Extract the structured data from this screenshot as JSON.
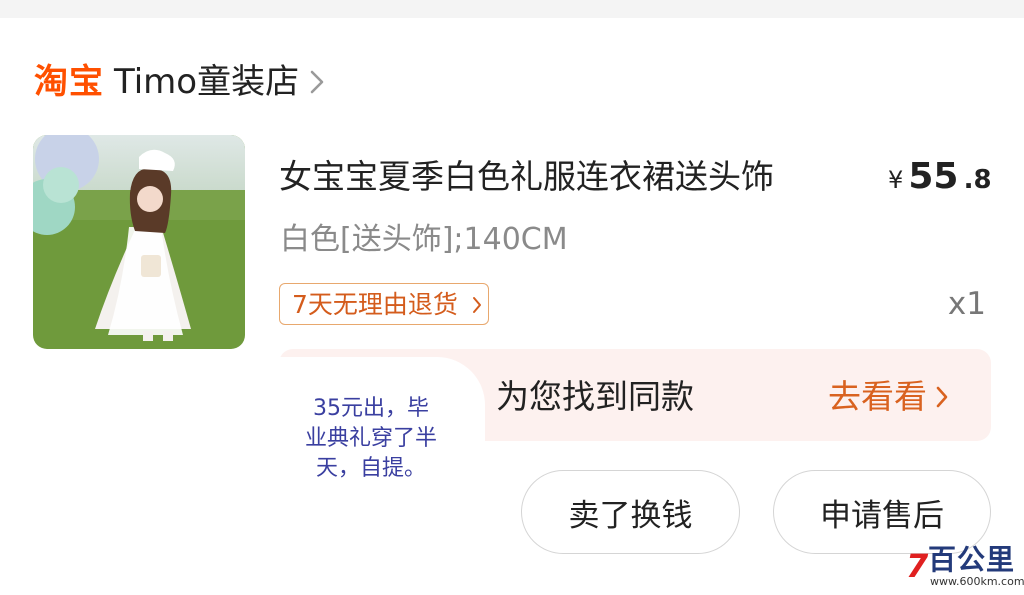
{
  "store": {
    "platform_logo": "淘宝",
    "name": "Timo童装店"
  },
  "product": {
    "title": "女宝宝夏季白色礼服连衣裙送头饰",
    "price": {
      "currency": "¥",
      "integer": "55",
      "decimal": ".8"
    },
    "variant": "白色[送头饰];140CM",
    "badge": "7天无理由退货",
    "quantity": "x1"
  },
  "similar": {
    "text": "为您找到同款",
    "link_label": "去看看"
  },
  "overlay_note": {
    "lines": [
      "35元出，毕",
      "业典礼穿了半",
      "天，自提。"
    ]
  },
  "actions": {
    "sell_label": "卖了换钱",
    "after_sale_label": "申请售后"
  },
  "watermark": {
    "mark": "7",
    "name": "百公里",
    "url": "www.600km.com"
  },
  "colors": {
    "brand_orange": "#ff5000",
    "link_orange": "#d9621f",
    "similar_bg": "#fdf1ef",
    "note_blue": "#3a3fa0"
  }
}
